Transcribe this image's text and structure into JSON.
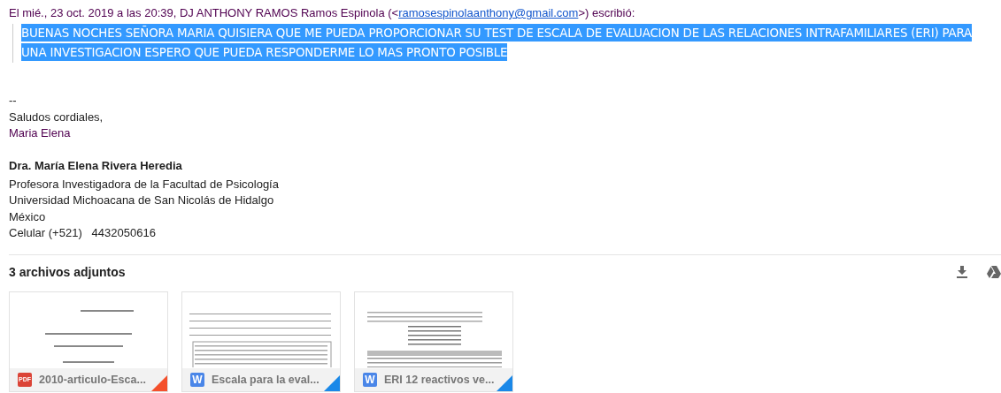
{
  "quote_header": {
    "prefix": "El mié., 23 oct. 2019 a las 20:39, DJ ANTHONY RAMOS Ramos Espinola (<",
    "email": "ramosespinolaanthony@gmail.com",
    "suffix": ">) escribió:"
  },
  "quoted_message": {
    "lines": [
      "BUENAS NOCHES SEÑORA MARIA QUISIERA QUE ME PUEDA PROPORCIONAR SU TEST DE ESCALA DE EVALUACION DE LAS RELACIONES INTRAFAMILIARES (ERI) PARA",
      "UNA INVESTIGACION ESPERO QUE PUEDA RESPONDERME LO MAS PRONTO POSIBLE"
    ],
    "selected": true
  },
  "signature": {
    "separator": "--",
    "greeting": [
      "Saludos cordiales,",
      "Maria Elena"
    ],
    "name": "Dra. María Elena Rivera Heredia",
    "lines": [
      "Profesora Investigadora de la Facultad de Psicología",
      "Universidad Michoacana de San Nicolás de Hidalgo",
      "México",
      "Celular (+521)   4432050616"
    ]
  },
  "attachments": {
    "title": "3 archivos adjuntos",
    "files": [
      {
        "kind": "pdf",
        "badge": "PDF",
        "name": "2010-articulo-Esca..."
      },
      {
        "kind": "word",
        "badge": "W",
        "name": "Escala para la eval..."
      },
      {
        "kind": "word",
        "badge": "W",
        "name": "ERI 12 reactivos ve..."
      }
    ]
  }
}
